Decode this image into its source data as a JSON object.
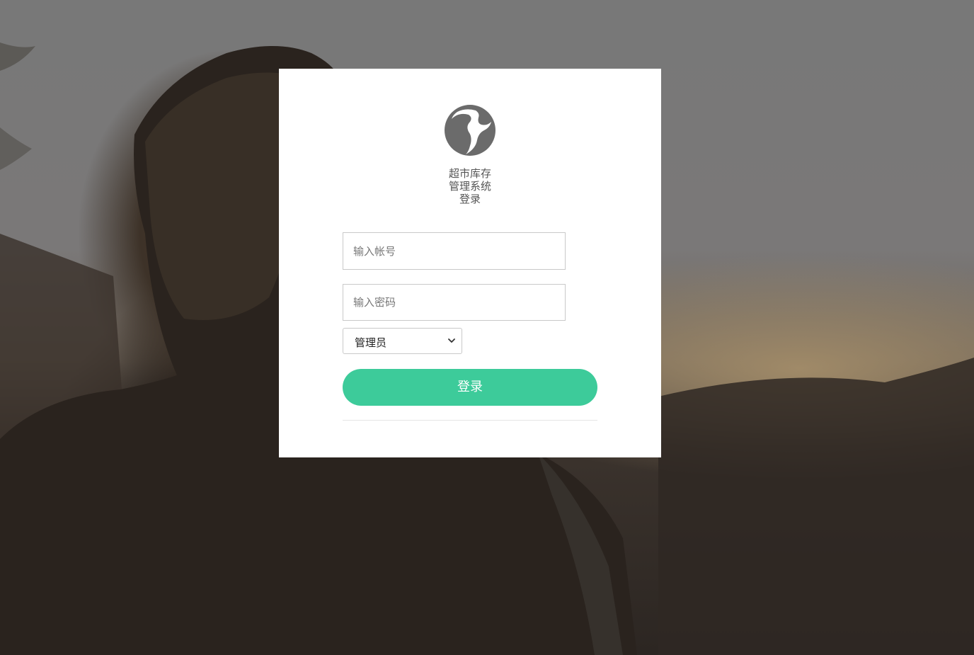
{
  "app": {
    "title_lines": [
      "超市库存",
      "管理系统",
      "登录"
    ]
  },
  "icons": {
    "logo": "globe-logo-icon",
    "select_arrow": "chevron-down-icon"
  },
  "form": {
    "account_placeholder": "输入帐号",
    "password_placeholder": "输入密码",
    "role_selected": "管理员",
    "login_label": "登录"
  },
  "colors": {
    "accent": "#3dcb9a",
    "card": "#ffffff",
    "logo": "#6b6b6b"
  }
}
